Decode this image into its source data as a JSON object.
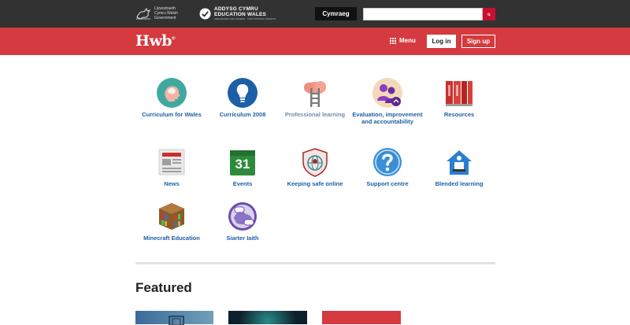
{
  "govbar": {
    "gov_logo_text": "Llywodraeth Cymru Welsh Government",
    "edu_line1": "ADDYSG CYMRU",
    "edu_line2": "EDUCATION WALES",
    "edu_line3": "CENHADAETH EIN CENEDL · OUR NATIONAL MISSION",
    "language_button": "Cymraeg",
    "search_placeholder": ""
  },
  "header": {
    "brand": "Hwb",
    "brand_mark": "®",
    "menu_label": "Menu",
    "login_label": "Log in",
    "signup_label": "Sign up"
  },
  "tiles": [
    {
      "label": "Curriculum for Wales",
      "icon": "head-icon"
    },
    {
      "label": "Curriculum 2008",
      "icon": "lightbulb-icon"
    },
    {
      "label": "Professional learning",
      "icon": "ladder-cloud-icon"
    },
    {
      "label": "Evaluation, improvement and accountability",
      "icon": "people-growth-icon"
    },
    {
      "label": "Resources",
      "icon": "books-icon"
    },
    {
      "label": "News",
      "icon": "newspaper-icon"
    },
    {
      "label": "Events",
      "icon": "calendar-icon"
    },
    {
      "label": "Keeping safe online",
      "icon": "shield-globe-icon"
    },
    {
      "label": "Support centre",
      "icon": "question-icon"
    },
    {
      "label": "Blended learning",
      "icon": "house-laptop-icon"
    },
    {
      "label": "Minecraft Education",
      "icon": "minecraft-bookshelf-icon"
    },
    {
      "label": "Siarter Iaith",
      "icon": "speech-globe-icon"
    }
  ],
  "events_day": "31",
  "featured_title": "Featured",
  "colors": {
    "govbar": "#323232",
    "header_red": "#d43a3f",
    "link_blue": "#1f5fa6"
  }
}
